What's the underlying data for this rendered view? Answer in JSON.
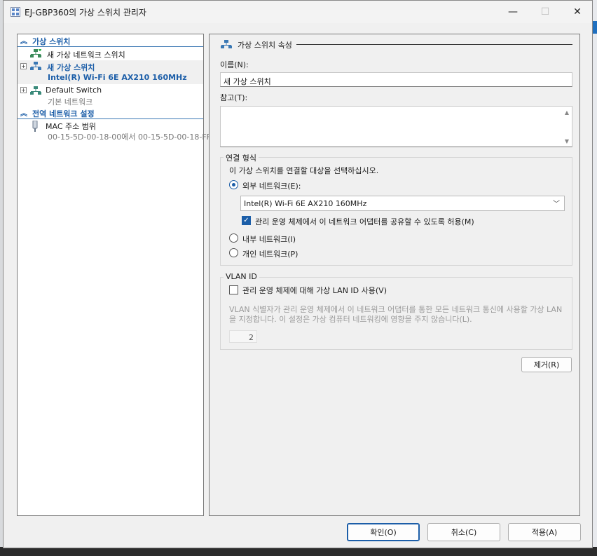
{
  "window": {
    "title": "EJ-GBP360의 가상 스위치 관리자"
  },
  "titlebar": {
    "minimize": "—",
    "maximize": "☐",
    "close": "✕"
  },
  "left": {
    "virtual_switches_header": "가상 스위치",
    "new_switch_item": "새 가상 네트워크 스위치",
    "switches": [
      {
        "name": "새 가상 스위치",
        "sub": "Intel(R) Wi-Fi 6E AX210 160MHz"
      },
      {
        "name": "Default Switch",
        "sub": "기본 네트워크"
      }
    ],
    "global_header": "전역 네트워크 설정",
    "mac": {
      "name": "MAC 주소 범위",
      "range": "00-15-5D-00-18-00에서 00-15-5D-00-18-FF"
    }
  },
  "props": {
    "header": "가상 스위치 속성",
    "name_label": "이름(N):",
    "name_value": "새 가상 스위치",
    "notes_label": "참고(T):",
    "notes_value": "",
    "conn_group": "연결 형식",
    "conn_desc": "이 가상 스위치를 연결할 대상을 선택하십시오.",
    "external": "외부 네트워크(E):",
    "external_adapter": "Intel(R) Wi-Fi 6E AX210 160MHz",
    "allow_share": "관리 운영 체제에서 이 네트워크 어댑터를 공유할 수 있도록 허용(M)",
    "internal": "내부 네트워크(I)",
    "private": "개인 네트워크(P)",
    "connection_type": "external",
    "vlan_group": "VLAN ID",
    "vlan_enable": "관리 운영 체제에 대해 가상 LAN ID 사용(V)",
    "vlan_desc": "VLAN 식별자가 관리 운영 체제에서 이 네트워크 어댑터를 통한 모든 네트워크 통신에 사용할 가상 LAN을 지정합니다. 이 설정은 가상 컴퓨터 네트워킹에 영향을 주지 않습니다(L).",
    "vlan_value": "2",
    "remove": "제거(R)"
  },
  "buttons": {
    "ok": "확인(O)",
    "cancel": "취소(C)",
    "apply": "적용(A)"
  },
  "colors": {
    "accent": "#1c5ea8"
  }
}
